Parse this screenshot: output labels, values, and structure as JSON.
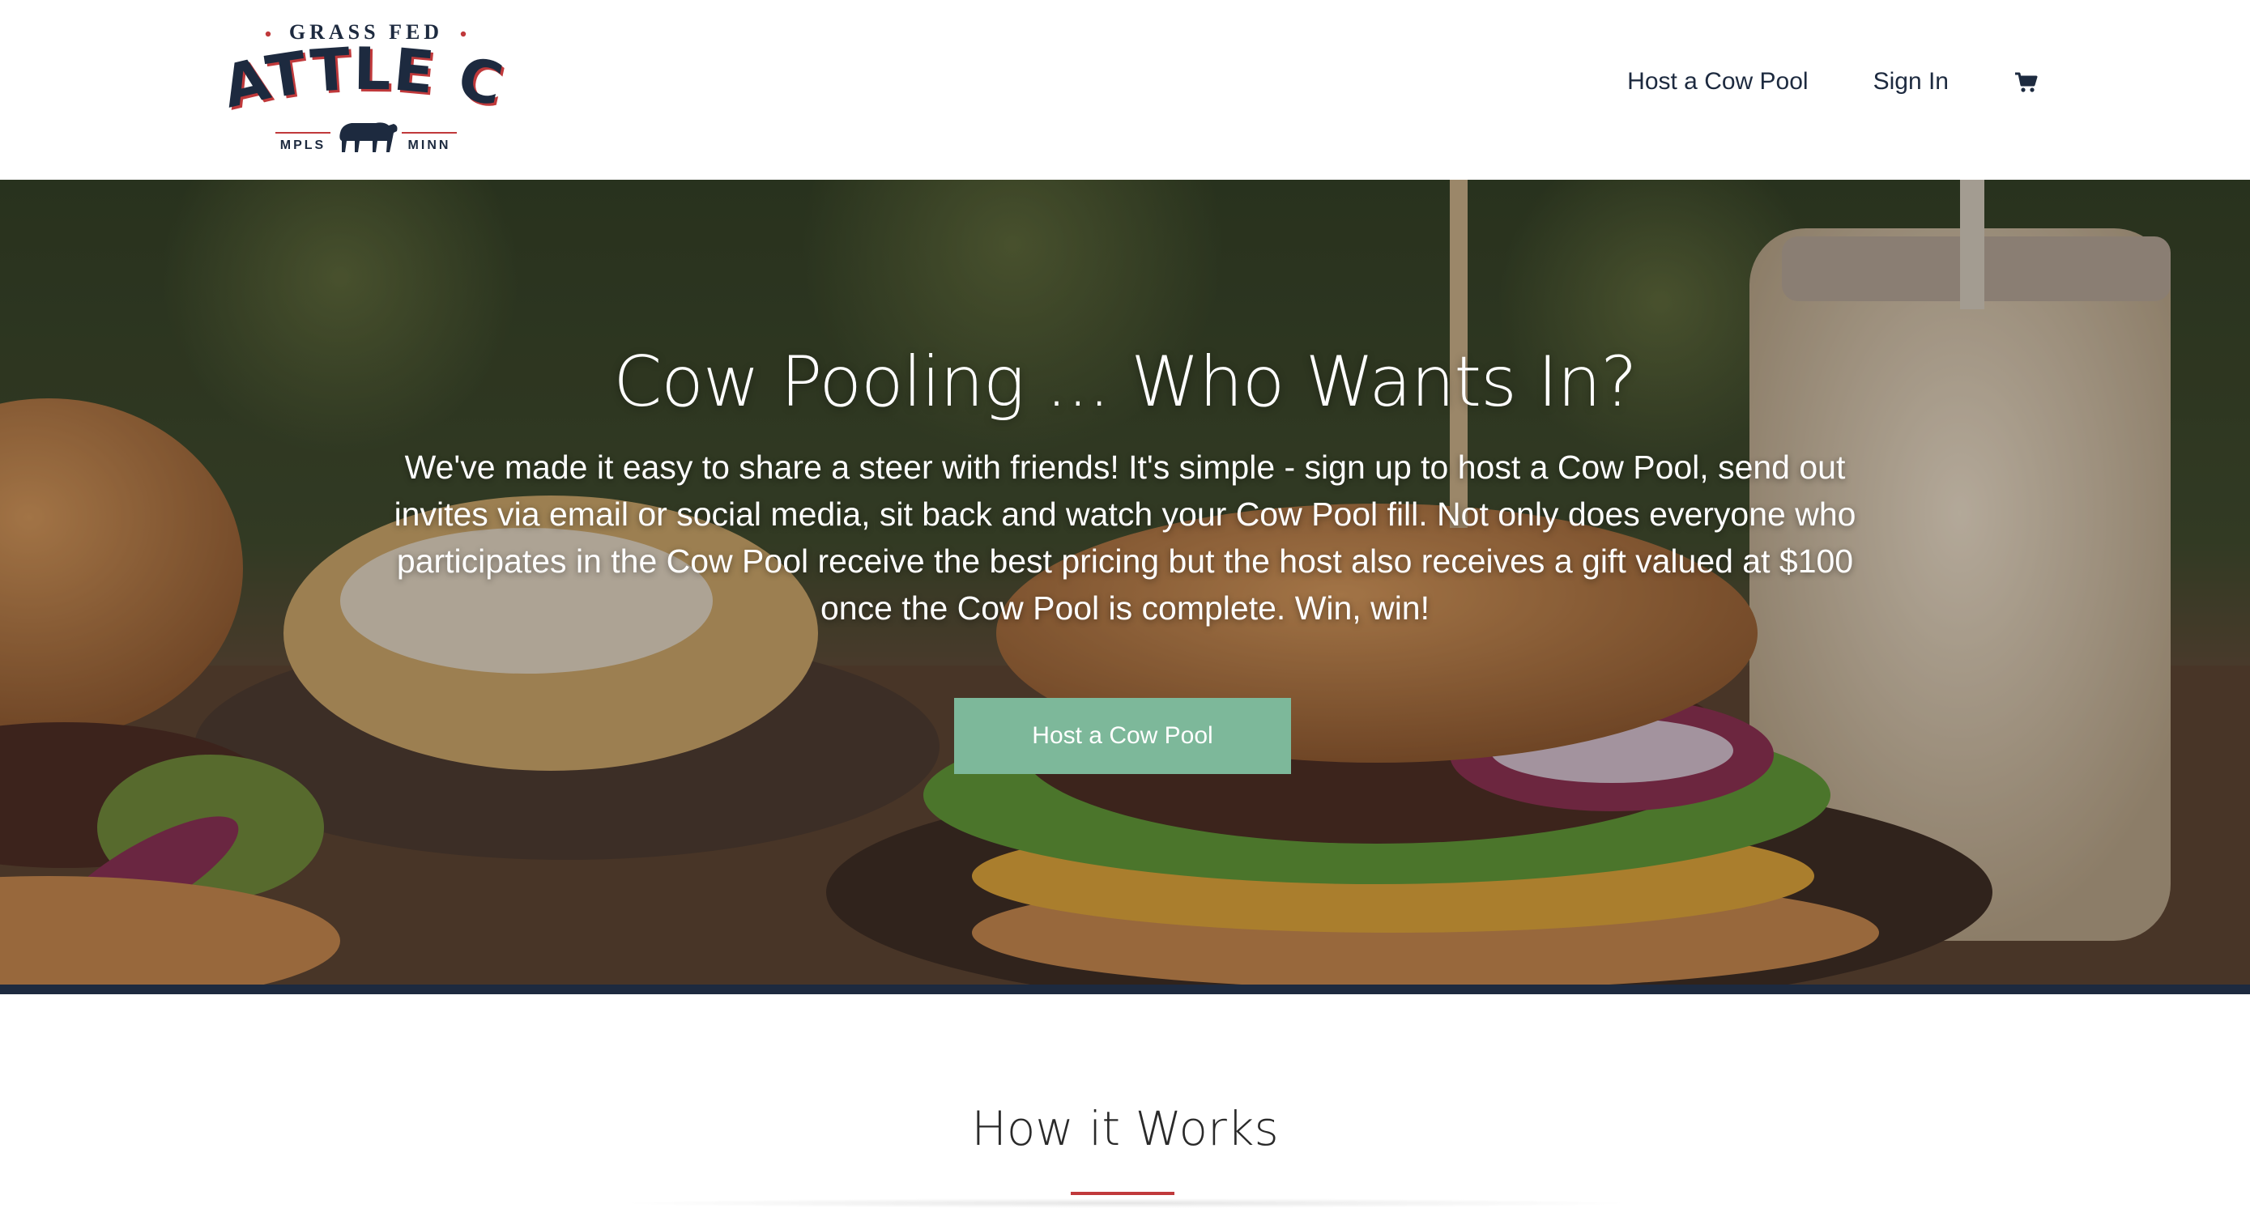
{
  "brand": {
    "top_line": "GRASS FED",
    "name": "CATTLE CO",
    "city_left": "MPLS",
    "city_right": "MINN",
    "navy": "#1d2a3f",
    "red": "#c0393b"
  },
  "nav": {
    "items": [
      {
        "label": "Host a Cow Pool"
      },
      {
        "label": "Sign In"
      }
    ],
    "cart_icon": "shopping-cart-icon"
  },
  "hero": {
    "title": "Cow Pooling ... Who Wants In?",
    "text": "We've made it easy to share a steer with friends! It's simple - sign up to host a Cow Pool, send out invites via email or social media, sit back and watch your Cow Pool fill. Not only does everyone who participates in the Cow Pool receive the best pricing but the host also receives a gift valued at $100 once the Cow Pool is complete. Win, win!",
    "button_label": "Host a Cow Pool",
    "button_color": "#7db89a"
  },
  "how_it_works": {
    "title": "How it Works"
  }
}
